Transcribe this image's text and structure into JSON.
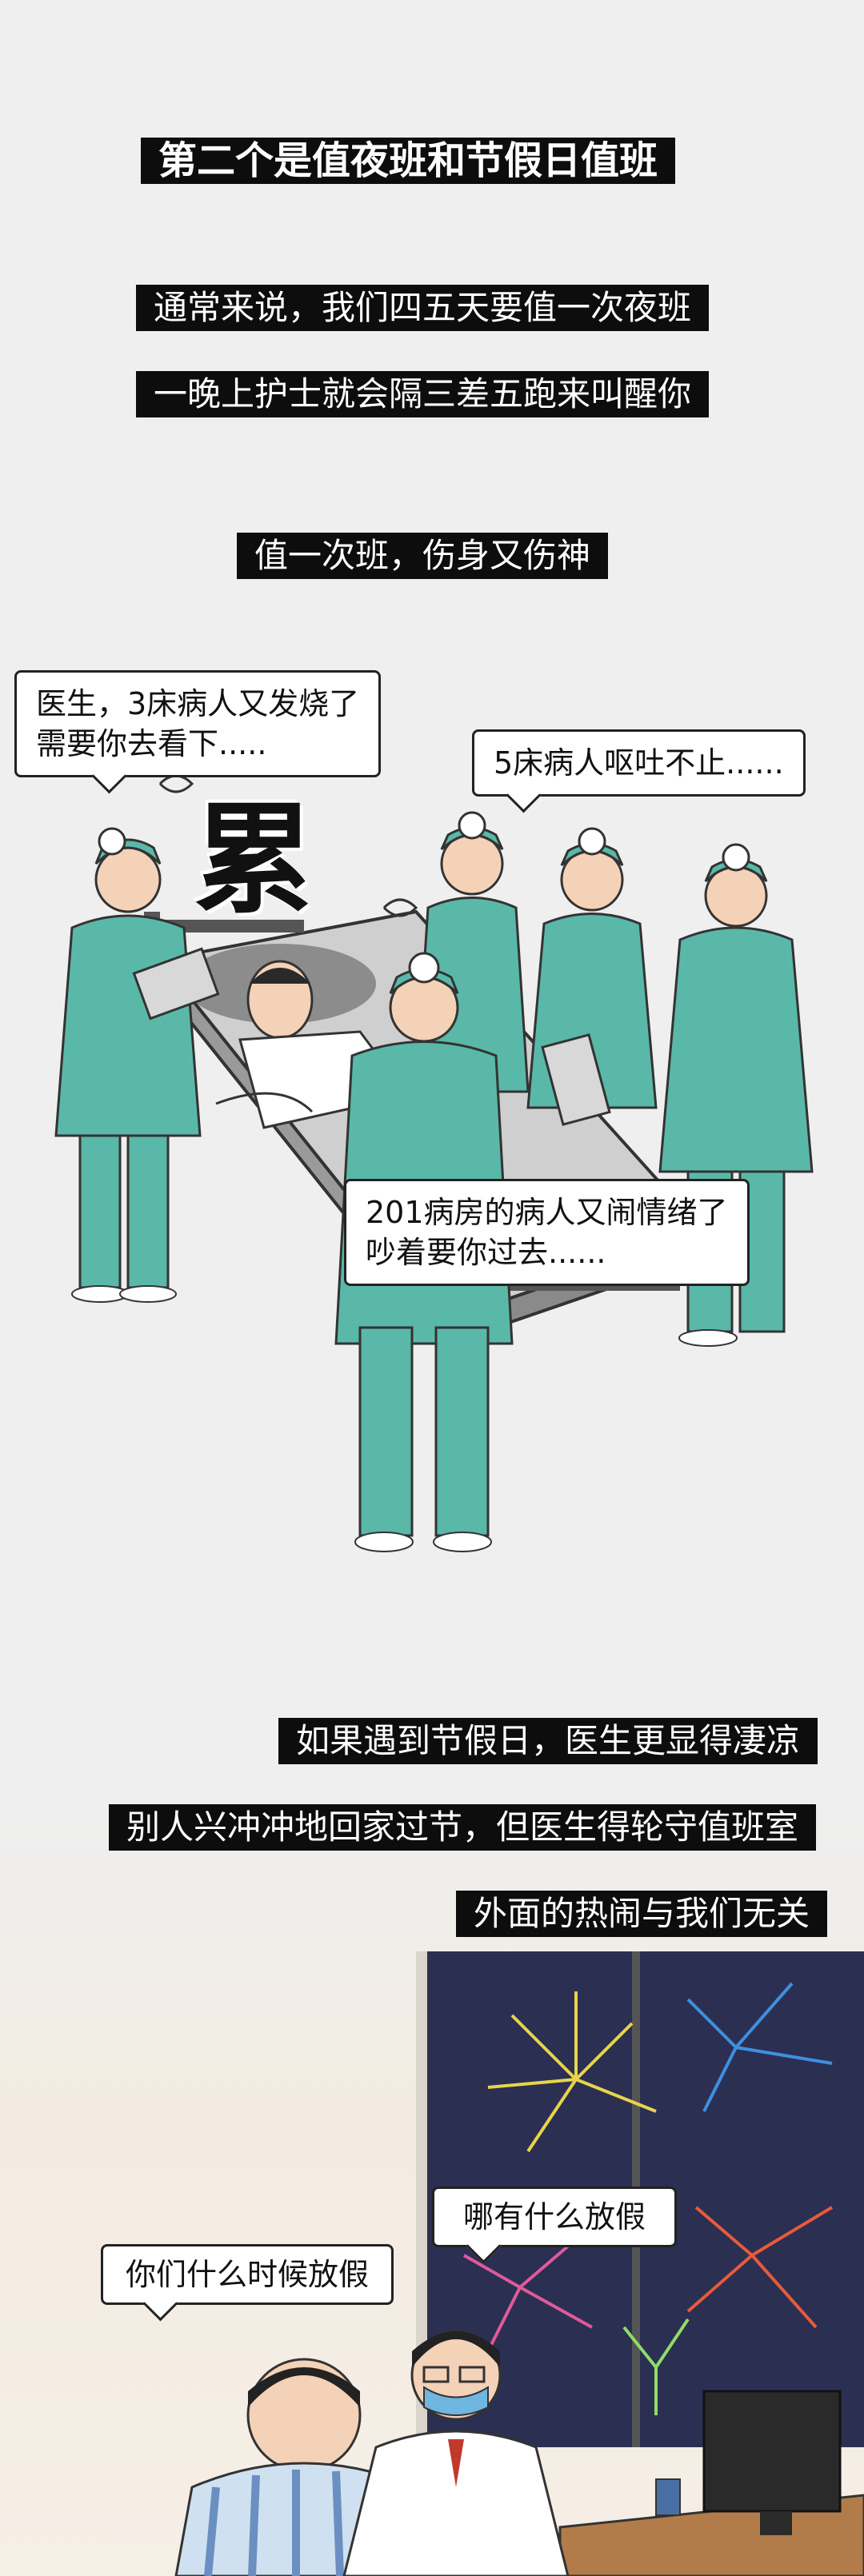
{
  "title": "第二个是值夜班和节假日值班",
  "captions": {
    "line1": "通常来说，我们四五天要值一次夜班",
    "line2": "一晚上护士就会隔三差五跑来叫醒你",
    "line3": "值一次班，伤身又伤神",
    "line4": "如果遇到节假日，医生更显得凄凉",
    "line5": "别人兴冲冲地回家过节，但医生得轮守值班室",
    "line6": "外面的热闹与我们无关"
  },
  "bubbles": {
    "b1_line1": "医生，3床病人又发烧了",
    "b1_line2": "需要你去看下.....",
    "b2": "5床病人呕吐不止......",
    "b3_line1": "201病房的病人又闹情绪了",
    "b3_line2": "吵着要你过去......",
    "b4": "哪有什么放假",
    "b5": "你们什么时候放假"
  },
  "stamp": "累",
  "colors": {
    "caption_bg": "#0d0d0d",
    "scrubs": "#5ab8a8",
    "night_sky": "#2b2f52"
  },
  "icons": [
    "clock-icon",
    "fireworks",
    "computer-monitor"
  ]
}
